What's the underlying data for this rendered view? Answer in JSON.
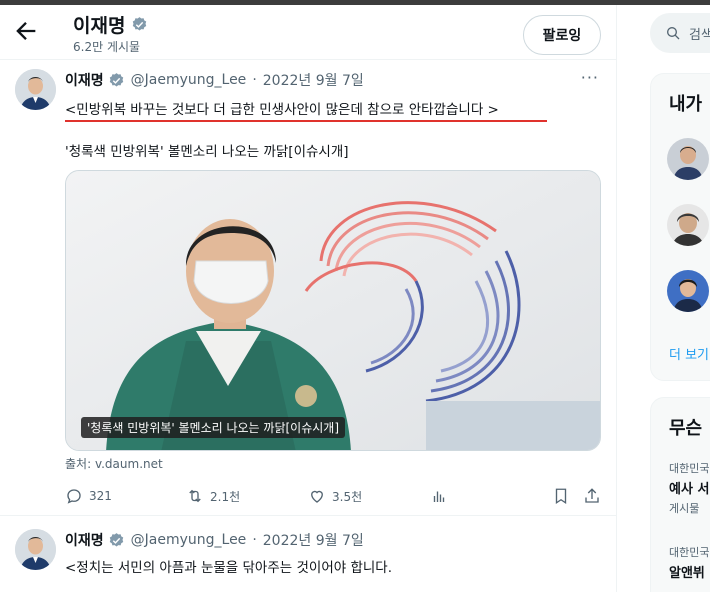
{
  "header": {
    "name": "이재명",
    "post_count": "6.2만 게시물",
    "follow_label": "팔로잉"
  },
  "tweet1": {
    "name": "이재명",
    "handle": "@Jaemyung_Lee",
    "separator": "·",
    "date": "2022년 9월 7일",
    "more": "···",
    "text": "<민방위복 바꾸는 것보다 더 급한 민생사안이 많은데 참으로 안타깝습니다 >",
    "card_title": "'청록색 민방위복' 볼멘소리 나오는 까닭[이슈시개]",
    "card_caption": "'청록색 민방위복' 볼멘소리 나오는 까닭[이슈시개]",
    "source": "출처: v.daum.net",
    "actions": {
      "replies": "321",
      "retweets": "2.1천",
      "likes": "3.5천"
    }
  },
  "tweet2": {
    "name": "이재명",
    "handle": "@Jaemyung_Lee",
    "separator": "·",
    "date": "2022년 9월 7일",
    "text": "<정치는 서민의 아픔과 눈물을 닦아주는 것이어야 합니다."
  },
  "sidebar": {
    "search_placeholder": "검색",
    "who_to_follow_title": "내가",
    "show_more": "더 보기",
    "trends_title": "무슨",
    "trends": [
      {
        "category": "대한민국",
        "name": "예사 서"
      },
      {
        "category": "게시물",
        "name": ""
      },
      {
        "category": "대한민국",
        "name": "알앤뷔"
      }
    ]
  },
  "colors": {
    "accent": "#1d9bf0",
    "underline": "#e0322d",
    "muted": "#536471"
  }
}
